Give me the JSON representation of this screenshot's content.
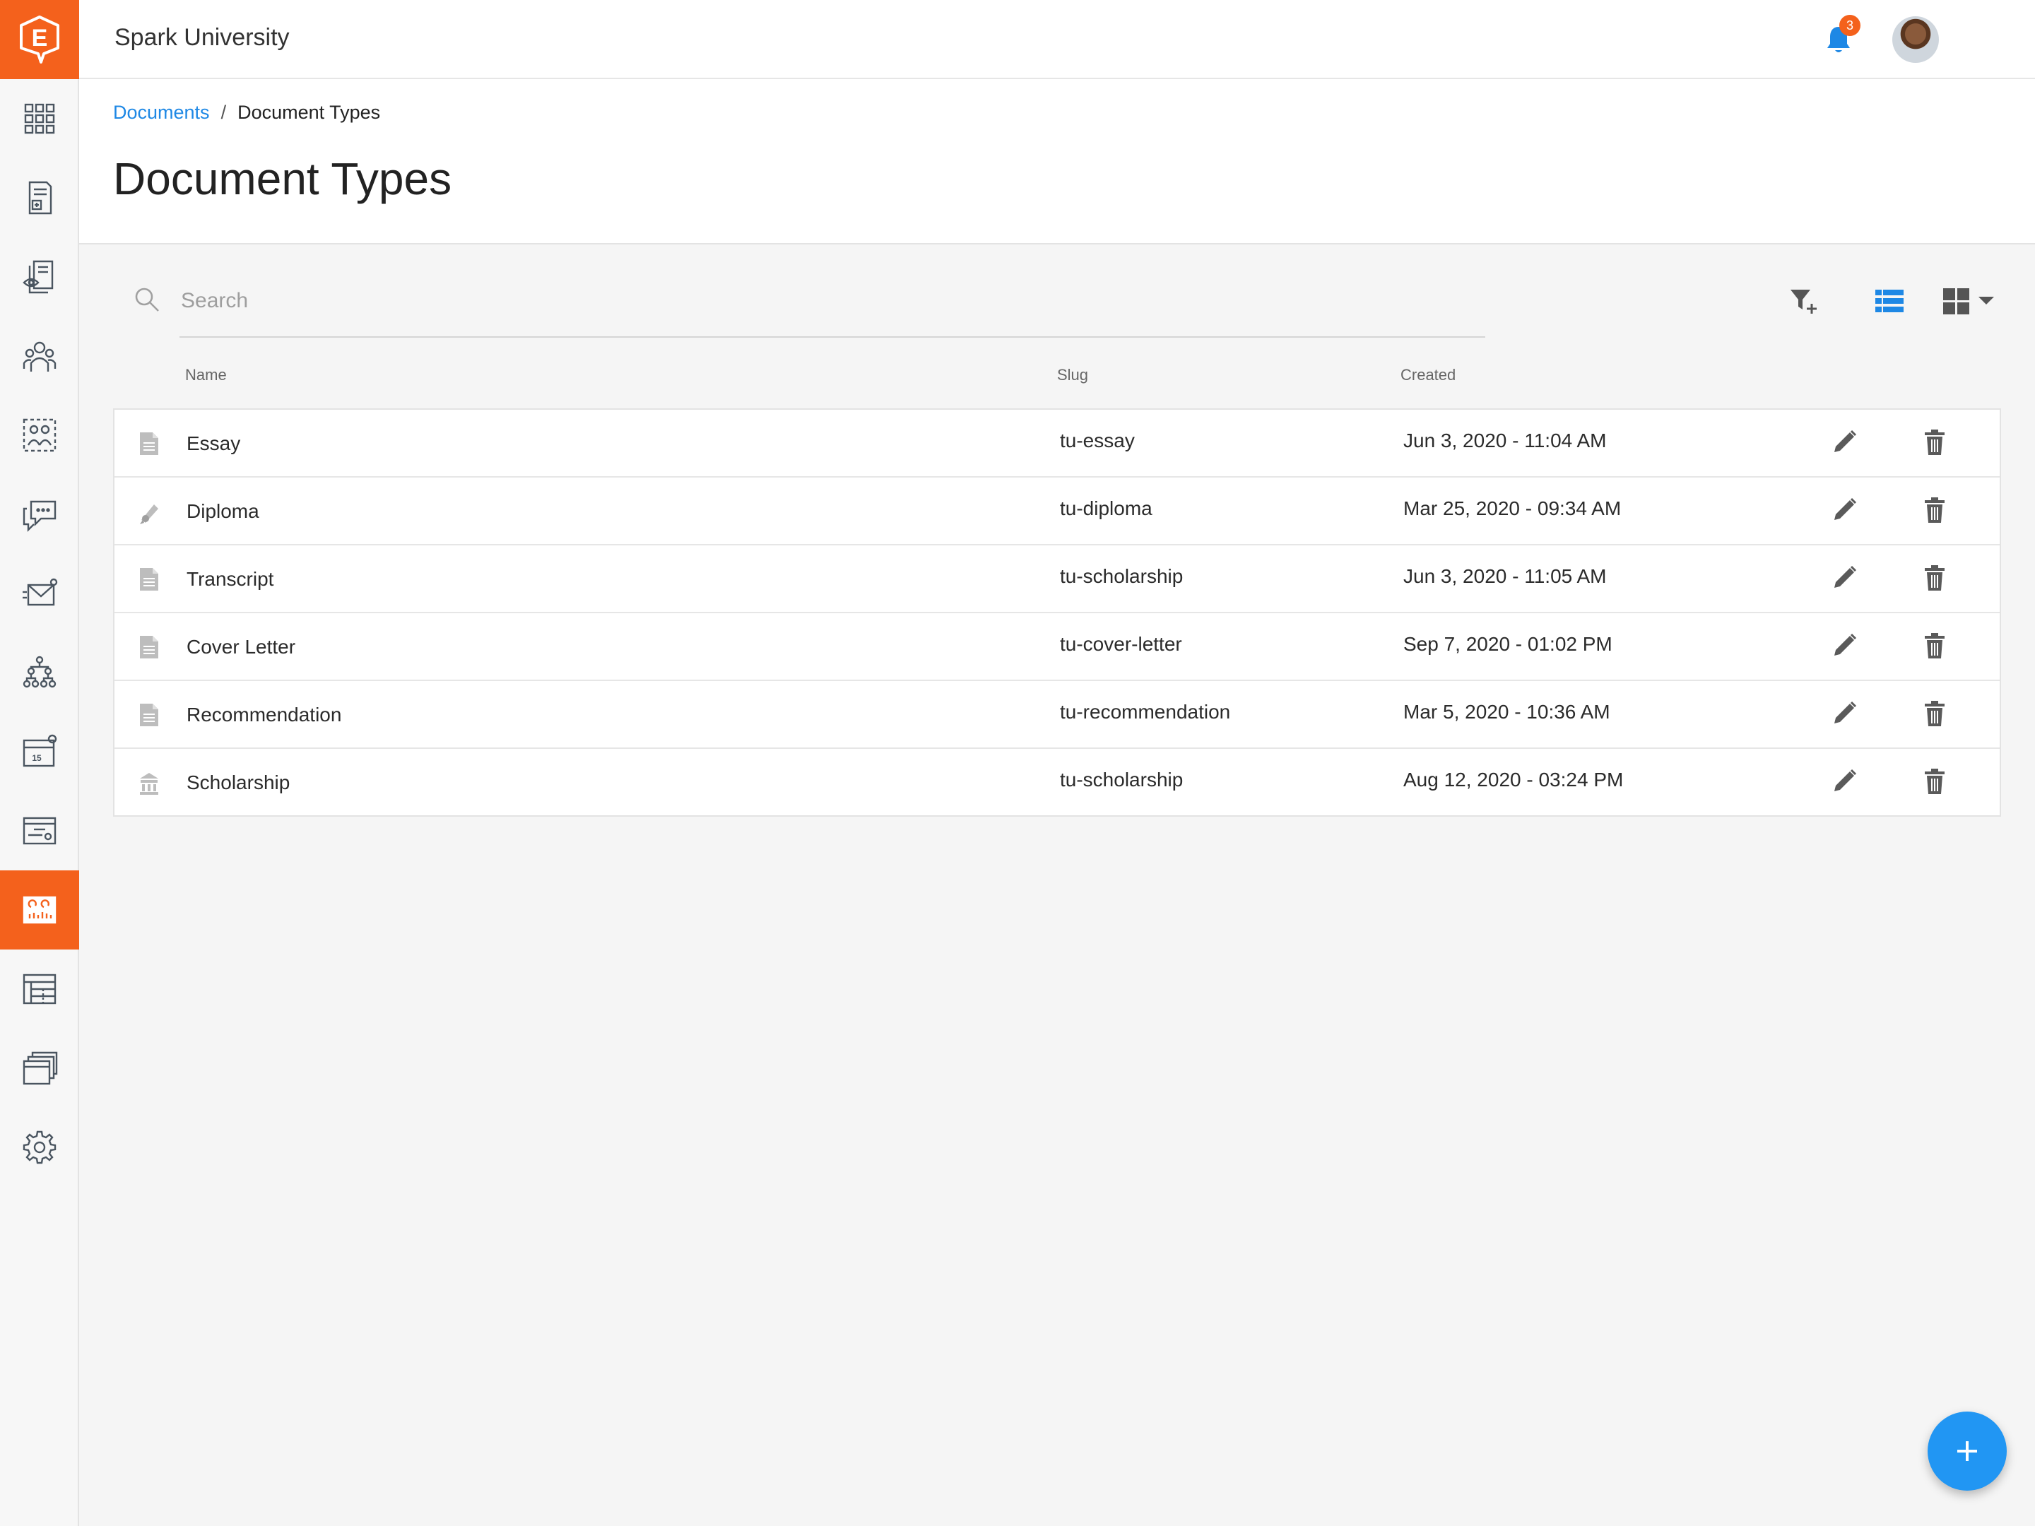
{
  "app": {
    "org_name": "Spark University",
    "logo_letter": "E",
    "accent_color": "#f4611c",
    "link_color": "#1e88e5",
    "fab_color": "#2196f3"
  },
  "notifications": {
    "count": "3",
    "icon": "bell-icon"
  },
  "sidebar": {
    "items": [
      {
        "icon": "dashboard-grid-icon"
      },
      {
        "icon": "document-plus-icon"
      },
      {
        "icon": "document-review-icon"
      },
      {
        "icon": "people-group-icon"
      },
      {
        "icon": "people-selection-icon"
      },
      {
        "icon": "chat-bubbles-icon"
      },
      {
        "icon": "send-mail-icon"
      },
      {
        "icon": "org-chart-icon"
      },
      {
        "icon": "calendar-icon"
      },
      {
        "icon": "form-settings-icon"
      },
      {
        "icon": "analytics-board-icon",
        "active": true
      },
      {
        "icon": "spreadsheet-icon"
      },
      {
        "icon": "files-stack-icon"
      },
      {
        "icon": "gear-icon"
      }
    ]
  },
  "breadcrumb": {
    "parent": "Documents",
    "separator": "/",
    "current": "Document Types"
  },
  "page_title": "Document Types",
  "search": {
    "placeholder": "Search",
    "value": ""
  },
  "table": {
    "columns": {
      "name": "Name",
      "slug": "Slug",
      "created": "Created"
    },
    "rows": [
      {
        "icon": "document-icon",
        "name": "Essay",
        "slug": "tu-essay",
        "created": "Jun 3, 2020 - 11:04 AM"
      },
      {
        "icon": "diploma-icon",
        "name": "Diploma",
        "slug": "tu-diploma",
        "created": "Mar 25, 2020 - 09:34 AM"
      },
      {
        "icon": "document-icon",
        "name": "Transcript",
        "slug": "tu-scholarship",
        "created": "Jun 3, 2020 - 11:05 AM"
      },
      {
        "icon": "document-icon",
        "name": "Cover Letter",
        "slug": "tu-cover-letter",
        "created": "Sep 7, 2020 - 01:02 PM"
      },
      {
        "icon": "document-icon",
        "name": "Recommendation",
        "slug": "tu-recommendation",
        "created": "Mar 5, 2020 - 10:36 AM"
      },
      {
        "icon": "institution-icon",
        "name": "Scholarship",
        "slug": "tu-scholarship",
        "created": "Aug 12, 2020 - 03:24 PM"
      }
    ]
  },
  "fab": {
    "label": "+"
  }
}
